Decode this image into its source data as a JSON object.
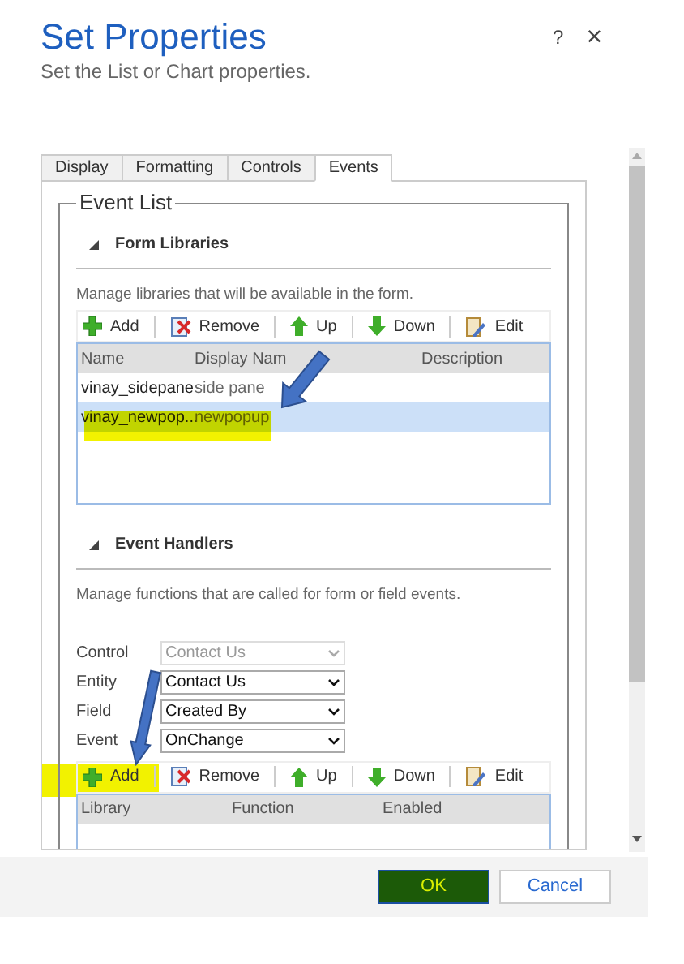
{
  "dialog": {
    "title": "Set Properties",
    "subtitle": "Set the List or Chart properties.",
    "help": "?",
    "close": "×"
  },
  "tabs": [
    {
      "label": "Display",
      "selected": false
    },
    {
      "label": "Formatting",
      "selected": false
    },
    {
      "label": "Controls",
      "selected": false
    },
    {
      "label": "Events",
      "selected": true
    }
  ],
  "event_list": {
    "legend": "Event List",
    "form_libraries": {
      "heading": "Form Libraries",
      "expanded": true,
      "description": "Manage libraries that will be available in the form.",
      "toolbar": [
        {
          "label": "Add",
          "kind": "add"
        },
        {
          "label": "Remove",
          "kind": "remove"
        },
        {
          "label": "Up",
          "kind": "up"
        },
        {
          "label": "Down",
          "kind": "down"
        },
        {
          "label": "Edit",
          "kind": "edit"
        }
      ],
      "columns": [
        "Name",
        "Display Nam",
        "Description"
      ],
      "rows": [
        {
          "cells": [
            "vinay_sidepane",
            "side pane"
          ],
          "selected": false
        },
        {
          "cells": [
            "vinay_newpop...",
            "newpopup"
          ],
          "selected": true
        }
      ]
    },
    "event_handlers": {
      "heading": "Event Handlers",
      "expanded": true,
      "description": "Manage functions that are called for form or field events.",
      "fields": [
        {
          "label": "Control",
          "value": "Contact Us",
          "disabled": true
        },
        {
          "label": "Entity",
          "value": "Contact Us",
          "disabled": false
        },
        {
          "label": "Field",
          "value": "Created By",
          "disabled": false
        },
        {
          "label": "Event",
          "value": "OnChange",
          "disabled": false
        }
      ],
      "toolbar": [
        {
          "label": "Add",
          "kind": "add"
        },
        {
          "label": "Remove",
          "kind": "remove"
        },
        {
          "label": "Up",
          "kind": "up"
        },
        {
          "label": "Down",
          "kind": "down"
        },
        {
          "label": "Edit",
          "kind": "edit"
        }
      ],
      "columns": [
        "Library",
        "Function",
        "Enabled"
      ]
    }
  },
  "footer": {
    "buttons": [
      {
        "label": "OK",
        "kind": "primary"
      },
      {
        "label": "Cancel",
        "kind": "secondary"
      }
    ]
  }
}
